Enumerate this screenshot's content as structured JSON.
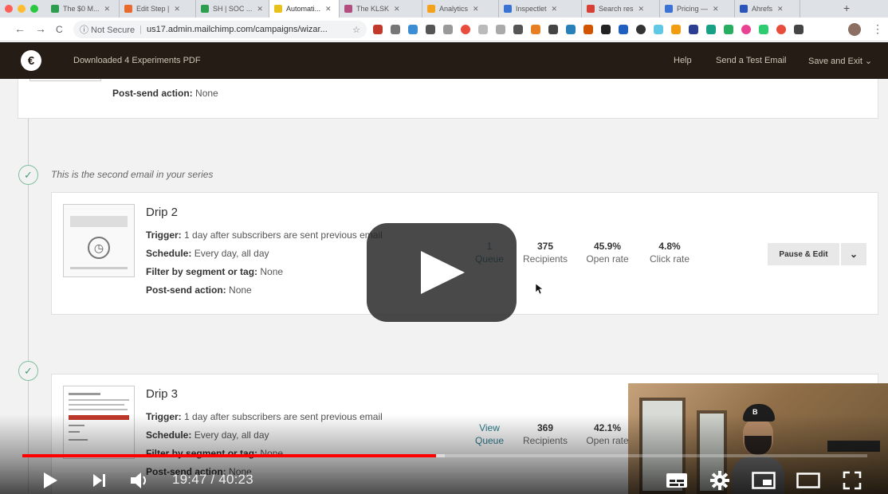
{
  "browser": {
    "tabs": [
      {
        "title": "The $0 M...",
        "active": false,
        "color": "#2e9d4f"
      },
      {
        "title": "Edit Step |",
        "active": false,
        "color": "#e86a2c"
      },
      {
        "title": "SH | SOC ...",
        "active": false,
        "color": "#2e9d4f"
      },
      {
        "title": "Automati...",
        "active": true,
        "color": "#e8c21a"
      },
      {
        "title": "The KLSK",
        "active": false,
        "color": "#b34d80"
      },
      {
        "title": "Analytics",
        "active": false,
        "color": "#f4a21b"
      },
      {
        "title": "Inspectlet",
        "active": false,
        "color": "#3b73d4"
      },
      {
        "title": "Search res",
        "active": false,
        "color": "#d64035"
      },
      {
        "title": "Pricing —",
        "active": false,
        "color": "#3b73d4"
      },
      {
        "title": "Ahrefs",
        "active": false,
        "color": "#2b55b8"
      }
    ],
    "close_glyph": "✕",
    "new_tab": "+",
    "security_label": "ⓘ Not Secure",
    "url": "us17.admin.mailchimp.com/campaigns/wizar...",
    "back_glyph": "←",
    "forward_glyph": "→",
    "reload_glyph": "C",
    "star_glyph": "☆",
    "menu_glyph": "⋮"
  },
  "mailchimp": {
    "logo_glyph": "€",
    "campaign_title": "Downloaded 4 Experiments PDF",
    "help": "Help",
    "send_test": "Send a Test Email",
    "save_exit": "Save and Exit ⌄",
    "colors": {
      "header_bg": "#241c15",
      "link_teal": "#2a7d8f"
    }
  },
  "previous_email": {
    "label": "Post-send action:",
    "value": " None"
  },
  "check_glyph": "✓",
  "series_note": "This is the second email in your series",
  "drip2": {
    "name": "Drip 2",
    "details": [
      {
        "label": "Trigger:",
        "value": " 1 day after subscribers are sent previous email"
      },
      {
        "label": "Schedule:",
        "value": " Every day, all day"
      },
      {
        "label": "Filter by segment or tag:",
        "value": " None"
      },
      {
        "label": "Post-send action:",
        "value": " None"
      }
    ],
    "stats": [
      {
        "value": "1",
        "label": "Queue",
        "link": true
      },
      {
        "value": "375",
        "label": "Recipients",
        "link": false
      },
      {
        "value": "45.9%",
        "label": "Open rate",
        "link": false
      },
      {
        "value": "4.8%",
        "label": "Click rate",
        "link": false
      }
    ],
    "pause_edit": "Pause & Edit",
    "dropdown_glyph": "⌄"
  },
  "drip3": {
    "name": "Drip 3",
    "details": [
      {
        "label": "Trigger:",
        "value": " 1 day after subscribers are sent previous email"
      },
      {
        "label": "Schedule:",
        "value": " Every day, all day"
      },
      {
        "label": "Filter by segment or tag:",
        "value": " None"
      },
      {
        "label": "Post-send action:",
        "value": " None"
      }
    ],
    "stats": [
      {
        "value": "View",
        "label": "Queue",
        "link": true
      },
      {
        "value": "369",
        "label": "Recipients",
        "link": false
      },
      {
        "value": "42.1%",
        "label": "Open rate",
        "link": false
      }
    ]
  },
  "video": {
    "current_time": "19:47",
    "duration": "40:23",
    "time_separator": " / ",
    "played_fraction": 0.49,
    "loaded_fraction": 0.5,
    "progress_color": "#ff0000",
    "webcam_cap_text": "B"
  }
}
